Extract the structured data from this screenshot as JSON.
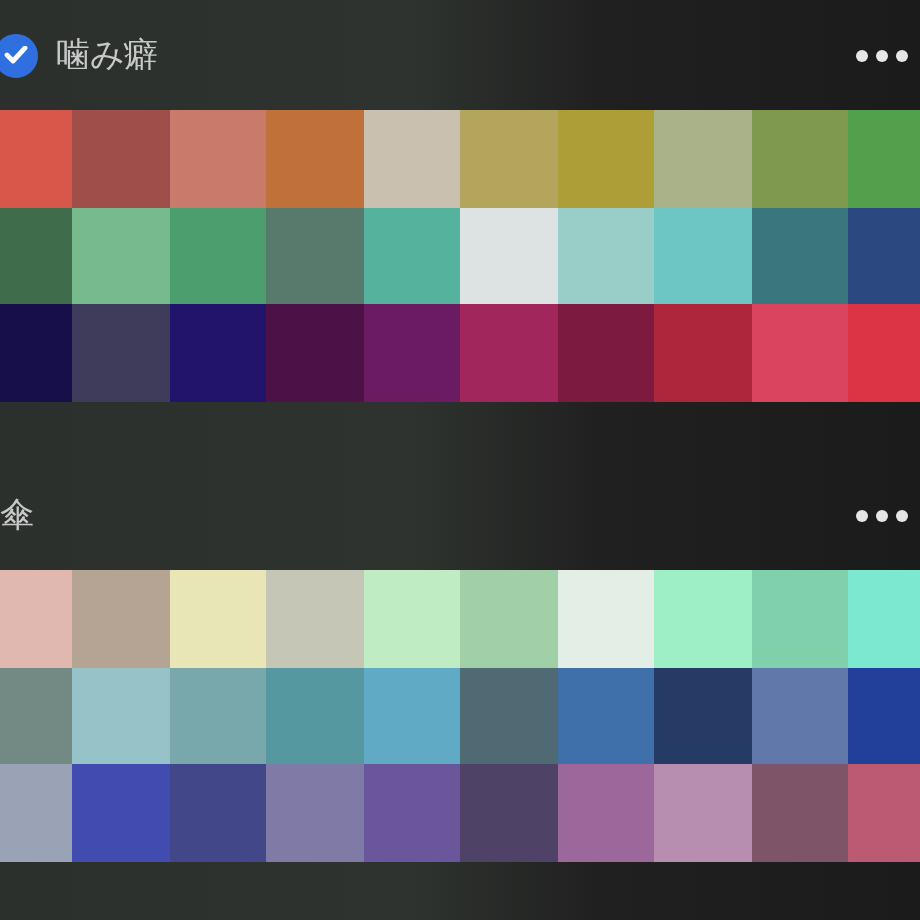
{
  "sections": [
    {
      "title": "噛み癖",
      "checked": true,
      "swatches": [
        {
          "color": "#d9574a"
        },
        {
          "color": "#9e4f4a"
        },
        {
          "color": "#c97a6a"
        },
        {
          "color": "#bf7139"
        },
        {
          "color": "#c9c0b0"
        },
        {
          "color": "#b3a55c"
        },
        {
          "color": "#ae9e38"
        },
        {
          "color": "#aab28a"
        },
        {
          "color": "#7f9a4e"
        },
        {
          "color": "#52a04c"
        },
        {
          "color": "#3f6c4a"
        },
        {
          "color": "#76ba8e"
        },
        {
          "color": "#4d9e6e"
        },
        {
          "color": "#577a6c"
        },
        {
          "color": "#55b29c"
        },
        {
          "color": "#dde2e3"
        },
        {
          "color": "#98cdc8"
        },
        {
          "color": "#6dc6c4"
        },
        {
          "color": "#3a767e"
        },
        {
          "color": "#2c4880"
        },
        {
          "color": "#170f4a"
        },
        {
          "color": "#3f3b5a"
        },
        {
          "color": "#21146a"
        },
        {
          "color": "#4c1248"
        },
        {
          "color": "#6b1b62"
        },
        {
          "color": "#a0265c"
        },
        {
          "color": "#7c1a40"
        },
        {
          "color": "#ad263c"
        },
        {
          "color": "#db445e"
        },
        {
          "color": "#dc3444"
        }
      ]
    },
    {
      "title": "傘",
      "swatches": [
        {
          "color": "#e0b8b0"
        },
        {
          "color": "#b5a393"
        },
        {
          "color": "#e8e5b6"
        },
        {
          "color": "#c5c6b6"
        },
        {
          "color": "#c0ecc4"
        },
        {
          "color": "#a0cfa8"
        },
        {
          "color": "#e2eee6"
        },
        {
          "color": "#9eeec6"
        },
        {
          "color": "#80d0ac"
        },
        {
          "color": "#7ce8d0"
        },
        {
          "color": "#738a84"
        },
        {
          "color": "#96c3c8"
        },
        {
          "color": "#78a8ac"
        },
        {
          "color": "#5598a0"
        },
        {
          "color": "#60aac6"
        },
        {
          "color": "#506a74"
        },
        {
          "color": "#4070aa"
        },
        {
          "color": "#263a66"
        },
        {
          "color": "#6078aa"
        },
        {
          "color": "#22409a"
        },
        {
          "color": "#9aa2b6"
        },
        {
          "color": "#424cb0"
        },
        {
          "color": "#42478a"
        },
        {
          "color": "#807aa6"
        },
        {
          "color": "#6a569a"
        },
        {
          "color": "#4e4266"
        },
        {
          "color": "#9c689c"
        },
        {
          "color": "#b88eb0"
        },
        {
          "color": "#7e5468"
        },
        {
          "color": "#bc5a72"
        }
      ]
    }
  ]
}
